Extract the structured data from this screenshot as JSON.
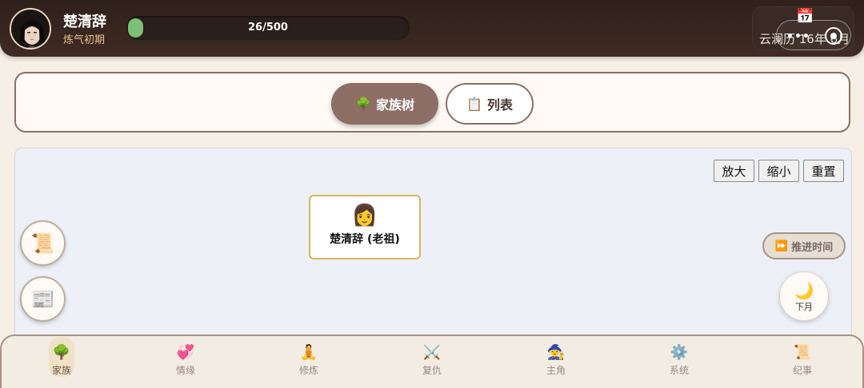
{
  "player": {
    "name": "楚清辞",
    "realm": "炼气初期"
  },
  "progress": {
    "text": "26/500",
    "current": 26,
    "max": 500
  },
  "calendar": {
    "date": "云澜历 16年 6月",
    "icon": "calendar-icon"
  },
  "tabs": [
    {
      "icon": "🌳",
      "label": "家族树",
      "active": true
    },
    {
      "icon": "📋",
      "label": "列表",
      "active": false
    }
  ],
  "zoom": {
    "in": "放大",
    "out": "缩小",
    "reset": "重置"
  },
  "family_node": {
    "icon": "👩",
    "label": "楚清辞 (老祖)"
  },
  "side_buttons": [
    {
      "icon": "📜",
      "name": "scroll-icon"
    },
    {
      "icon": "📰",
      "name": "newspaper-icon"
    }
  ],
  "advance_time": {
    "icon": "⏩",
    "label": "推进时间"
  },
  "next_month": {
    "icon": "🌙",
    "label": "下月"
  },
  "nav": [
    {
      "icon": "🌳",
      "label": "家族"
    },
    {
      "icon": "💞",
      "label": "情缘"
    },
    {
      "icon": "🧘",
      "label": "修炼"
    },
    {
      "icon": "⚔️",
      "label": "复仇"
    },
    {
      "icon": "🧙",
      "label": "主角"
    },
    {
      "icon": "⚙️",
      "label": "系统"
    },
    {
      "icon": "📜",
      "label": "纪事"
    }
  ]
}
